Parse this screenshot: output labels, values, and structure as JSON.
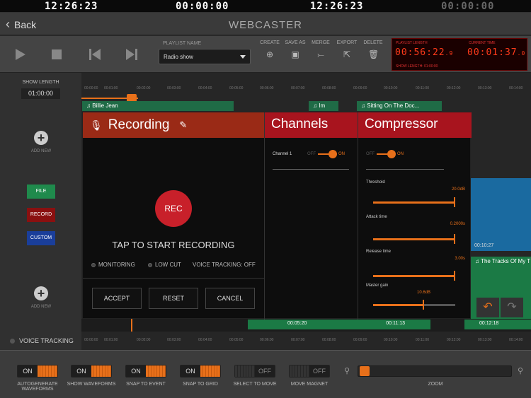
{
  "clocks": [
    "12:26:23",
    "00:00:00",
    "12:26:23",
    "00:00:00"
  ],
  "nav": {
    "back_label": "Back",
    "title": "WEBCASTER"
  },
  "playlist": {
    "label": "PLAYLIST NAME",
    "selected": "Radio show",
    "actions": [
      "CREATE",
      "SAVE AS",
      "MERGE",
      "EXPORT",
      "DELETE"
    ]
  },
  "length_panel": {
    "playlist_length_label": "PLAYLIST LENGTH",
    "playlist_length": "00:56:22",
    "playlist_length_frac": "9",
    "current_time_label": "CURRENT TIME",
    "current_time": "00:01:37",
    "current_time_frac": "0",
    "show_length_label": "SHOW LENGTH: 01:00:00"
  },
  "left": {
    "show_length_label": "SHOW LENGTH",
    "show_length_value": "01:00:00",
    "add_new_label": "ADD NEW",
    "file_label": "FILE",
    "record_label": "RECORD",
    "custom_label": "CUSTOM",
    "voice_tracking_label": "VOICE TRACKING"
  },
  "ruler_ticks": [
    "00:00:00",
    "00:01:00",
    "00:02:00",
    "00:03:00",
    "00:04:00",
    "00:05:00",
    "00:06:00",
    "00:07:00",
    "00:08:00",
    "00:09:00",
    "00:10:00",
    "00:11:00",
    "00:12:00",
    "00:13:00",
    "00:14:00"
  ],
  "tracks": {
    "billie": "Billie Jean",
    "im": "Im",
    "sitting": "Sitting On The Doc...",
    "tracks_of_my": "The Tracks Of My T",
    "t1": "00:05:20",
    "t2": "00:11:13",
    "t3": "00:12:18",
    "t4": "00:10:27"
  },
  "modal": {
    "recording": {
      "title": "Recording",
      "rec_label": "REC",
      "tap_text": "TAP TO START RECORDING",
      "monitoring": "MONITORING",
      "low_cut": "LOW CUT",
      "voice_tracking": "VOICE TRACKING: OFF",
      "accept": "ACCEPT",
      "reset": "RESET",
      "cancel": "CANCEL"
    },
    "channels": {
      "title": "Channels",
      "channel1": "Channel 1",
      "off": "OFF",
      "on": "ON"
    },
    "compressor": {
      "title": "Compressor",
      "off": "OFF",
      "on": "ON",
      "threshold_label": "Threshold",
      "threshold_value": "20.0dB",
      "attack_label": "Attack time",
      "attack_value": "0.2000s",
      "release_label": "Release time",
      "release_value": "3.00s",
      "gain_label": "Master gain",
      "gain_value": "10.6dB",
      "gain_level": 0.62
    }
  },
  "bottom": {
    "on": "ON",
    "off": "OFF",
    "autogen_label": "AUTOGENERATE WAVEFORMS",
    "show_waveforms_label": "SHOW WAVEFORMS",
    "snap_event_label": "SNAP TO EVENT",
    "snap_grid_label": "SNAP TO GRID",
    "select_move_label": "SELECT TO MOVE",
    "move_magnet_label": "MOVE MAGNET",
    "zoom_label": "ZOOM"
  },
  "colors": {
    "accent": "#e8701a",
    "modal_header": "#a8141e",
    "record_header": "#9a2a16",
    "track": "#1f6b46"
  }
}
